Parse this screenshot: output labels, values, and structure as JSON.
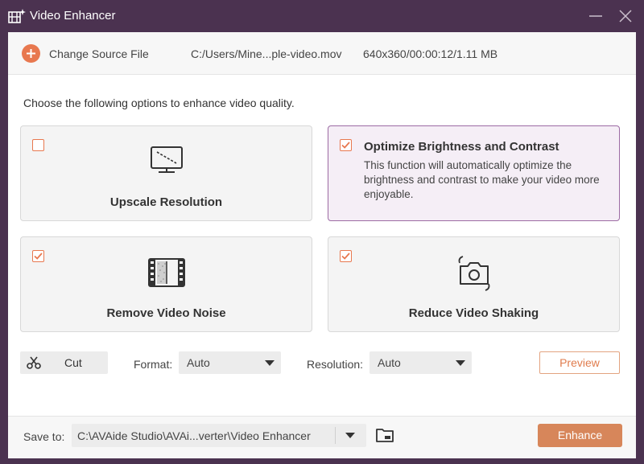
{
  "window": {
    "title": "Video Enhancer"
  },
  "source": {
    "change_label": "Change Source File",
    "path": "C:/Users/Mine...ple-video.mov",
    "info": "640x360/00:00:12/1.11 MB"
  },
  "instruction": "Choose the following options to enhance video quality.",
  "options": [
    {
      "title": "Upscale Resolution",
      "checked": false,
      "icon": "monitor-upscale-icon"
    },
    {
      "title": "Optimize Brightness and Contrast",
      "checked": true,
      "selected": true,
      "description": "This function will automatically optimize the brightness and contrast to make your video more enjoyable.",
      "icon": ""
    },
    {
      "title": "Remove Video Noise",
      "checked": true,
      "icon": "film-noise-icon"
    },
    {
      "title": "Reduce Video Shaking",
      "checked": true,
      "icon": "camera-stabilize-icon"
    }
  ],
  "controls": {
    "cut_label": "Cut",
    "format_label": "Format:",
    "format_value": "Auto",
    "resolution_label": "Resolution:",
    "resolution_value": "Auto",
    "preview_label": "Preview"
  },
  "footer": {
    "save_label": "Save to:",
    "save_path": "C:\\AVAide Studio\\AVAi...verter\\Video Enhancer",
    "enhance_label": "Enhance"
  },
  "colors": {
    "titlebar": "#4b3250",
    "accent_orange": "#e8784f",
    "enhance_button": "#d7865a",
    "selected_border": "#9d6ba4",
    "selected_bg": "#f5eef6"
  }
}
